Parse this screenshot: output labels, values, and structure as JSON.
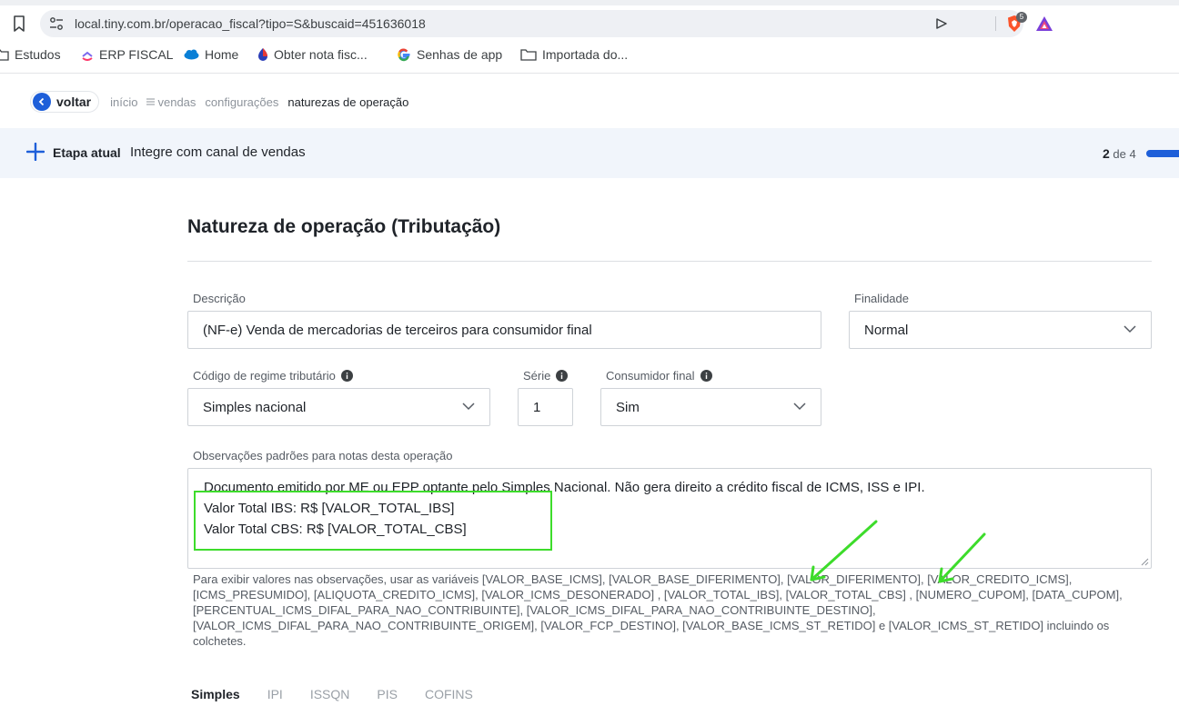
{
  "browser": {
    "url": "local.tiny.com.br/operacao_fiscal?tipo=S&buscaid=451636018",
    "brave_badge": "5",
    "bookmarks": [
      {
        "label": "Estudos",
        "icon": "folder-icon"
      },
      {
        "label": "ERP FISCAL",
        "icon": "clickup-icon"
      },
      {
        "label": "Home",
        "icon": "salesforce-cloud-icon"
      },
      {
        "label": "Obter nota fisc...",
        "icon": "drop-icon"
      },
      {
        "label": "Senhas de app",
        "icon": "google-icon"
      },
      {
        "label": "Importada do...",
        "icon": "folder-icon"
      }
    ]
  },
  "breadcrumbs": {
    "back_label": "voltar",
    "items": [
      "início",
      "vendas",
      "configurações"
    ],
    "current": "naturezas de operação"
  },
  "stage": {
    "label": "Etapa atual",
    "text": "Integre com canal de vendas",
    "current": "2",
    "of_label": "de 4",
    "progress_fraction": 0.5
  },
  "form": {
    "title": "Natureza de operação (Tributação)",
    "descricao": {
      "label": "Descrição",
      "value": "(NF-e) Venda de mercadorias de terceiros para consumidor final"
    },
    "finalidade": {
      "label": "Finalidade",
      "value": "Normal"
    },
    "regime": {
      "label": "Código de regime tributário",
      "value": "Simples nacional"
    },
    "serie": {
      "label": "Série",
      "value": "1"
    },
    "consumidor": {
      "label": "Consumidor final",
      "value": "Sim"
    },
    "observacoes": {
      "label": "Observações padrões para notas desta operação",
      "lines": [
        "Documento emitido por ME ou EPP optante pelo Simples Nacional. Não gera direito a crédito fiscal de ICMS, ISS e IPI.",
        "Valor Total IBS: R$ [VALOR_TOTAL_IBS]",
        "Valor Total CBS: R$ [VALOR_TOTAL_CBS]"
      ]
    },
    "help_text": "Para exibir valores nas observações, usar as variáveis [VALOR_BASE_ICMS], [VALOR_BASE_DIFERIMENTO], [VALOR_DIFERIMENTO], [VALOR_CREDITO_ICMS], [ICMS_PRESUMIDO], [ALIQUOTA_CREDITO_ICMS], [VALOR_ICMS_DESONERADO] , [VALOR_TOTAL_IBS], [VALOR_TOTAL_CBS] , [NUMERO_CUPOM], [DATA_CUPOM], [PERCENTUAL_ICMS_DIFAL_PARA_NAO_CONTRIBUINTE], [VALOR_ICMS_DIFAL_PARA_NAO_CONTRIBUINTE_DESTINO], [VALOR_ICMS_DIFAL_PARA_NAO_CONTRIBUINTE_ORIGEM], [VALOR_FCP_DESTINO], [VALOR_BASE_ICMS_ST_RETIDO] e [VALOR_ICMS_ST_RETIDO] incluindo os colchetes."
  },
  "tabs": [
    {
      "label": "Simples",
      "active": true
    },
    {
      "label": "IPI",
      "active": false
    },
    {
      "label": "ISSQN",
      "active": false
    },
    {
      "label": "PIS",
      "active": false
    },
    {
      "label": "COFINS",
      "active": false
    }
  ],
  "colors": {
    "accent": "#1e5fd9",
    "annotation": "#3ddc2b",
    "stage_bg": "#f1f5fb"
  }
}
